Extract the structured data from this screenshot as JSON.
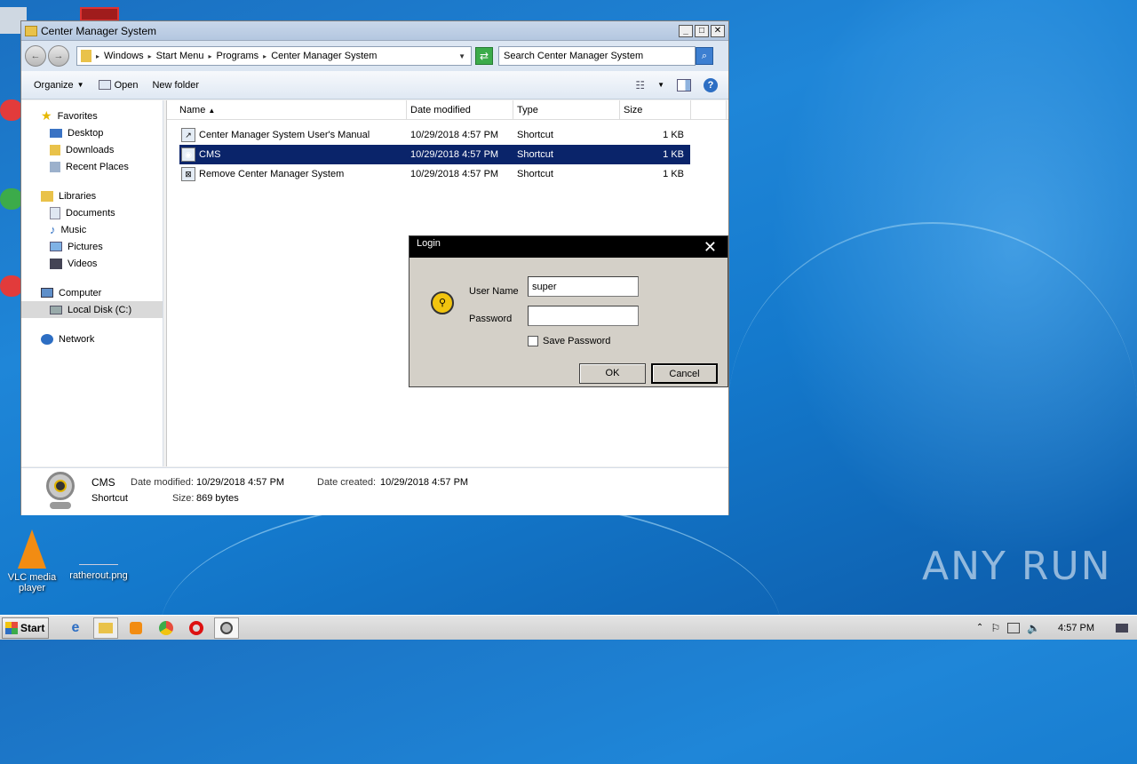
{
  "window": {
    "title": "Center Manager System"
  },
  "address": {
    "crumbs": [
      "Windows",
      "Start Menu",
      "Programs",
      "Center Manager System"
    ]
  },
  "search": {
    "placeholder": "Search Center Manager System"
  },
  "toolbar": {
    "organize": "Organize",
    "open": "Open",
    "new_folder": "New folder"
  },
  "nav": {
    "favorites": "Favorites",
    "desktop": "Desktop",
    "downloads": "Downloads",
    "recent": "Recent Places",
    "libraries": "Libraries",
    "documents": "Documents",
    "music": "Music",
    "pictures": "Pictures",
    "videos": "Videos",
    "computer": "Computer",
    "local_disk": "Local Disk (C:)",
    "network": "Network"
  },
  "columns": {
    "name": "Name",
    "date": "Date modified",
    "type": "Type",
    "size": "Size"
  },
  "files": [
    {
      "name": "Center Manager System User's Manual",
      "date": "10/29/2018 4:57 PM",
      "type": "Shortcut",
      "size": "1 KB"
    },
    {
      "name": "CMS",
      "date": "10/29/2018 4:57 PM",
      "type": "Shortcut",
      "size": "1 KB"
    },
    {
      "name": "Remove Center Manager System",
      "date": "10/29/2018 4:57 PM",
      "type": "Shortcut",
      "size": "1 KB"
    }
  ],
  "details": {
    "name": "CMS",
    "kind": "Shortcut",
    "modified_label": "Date modified:",
    "modified": "10/29/2018 4:57 PM",
    "created_label": "Date created:",
    "created": "10/29/2018 4:57 PM",
    "size_label": "Size:",
    "size": "869 bytes"
  },
  "login": {
    "title": "Login",
    "user_label": "User Name",
    "user_value": "super",
    "password_label": "Password",
    "save_password": "Save Password",
    "ok": "OK",
    "cancel": "Cancel"
  },
  "desktop": {
    "vlc": "VLC media player",
    "file": "ratherout.png"
  },
  "taskbar": {
    "start": "Start",
    "clock": "4:57 PM"
  },
  "watermark": "ANY RUN"
}
